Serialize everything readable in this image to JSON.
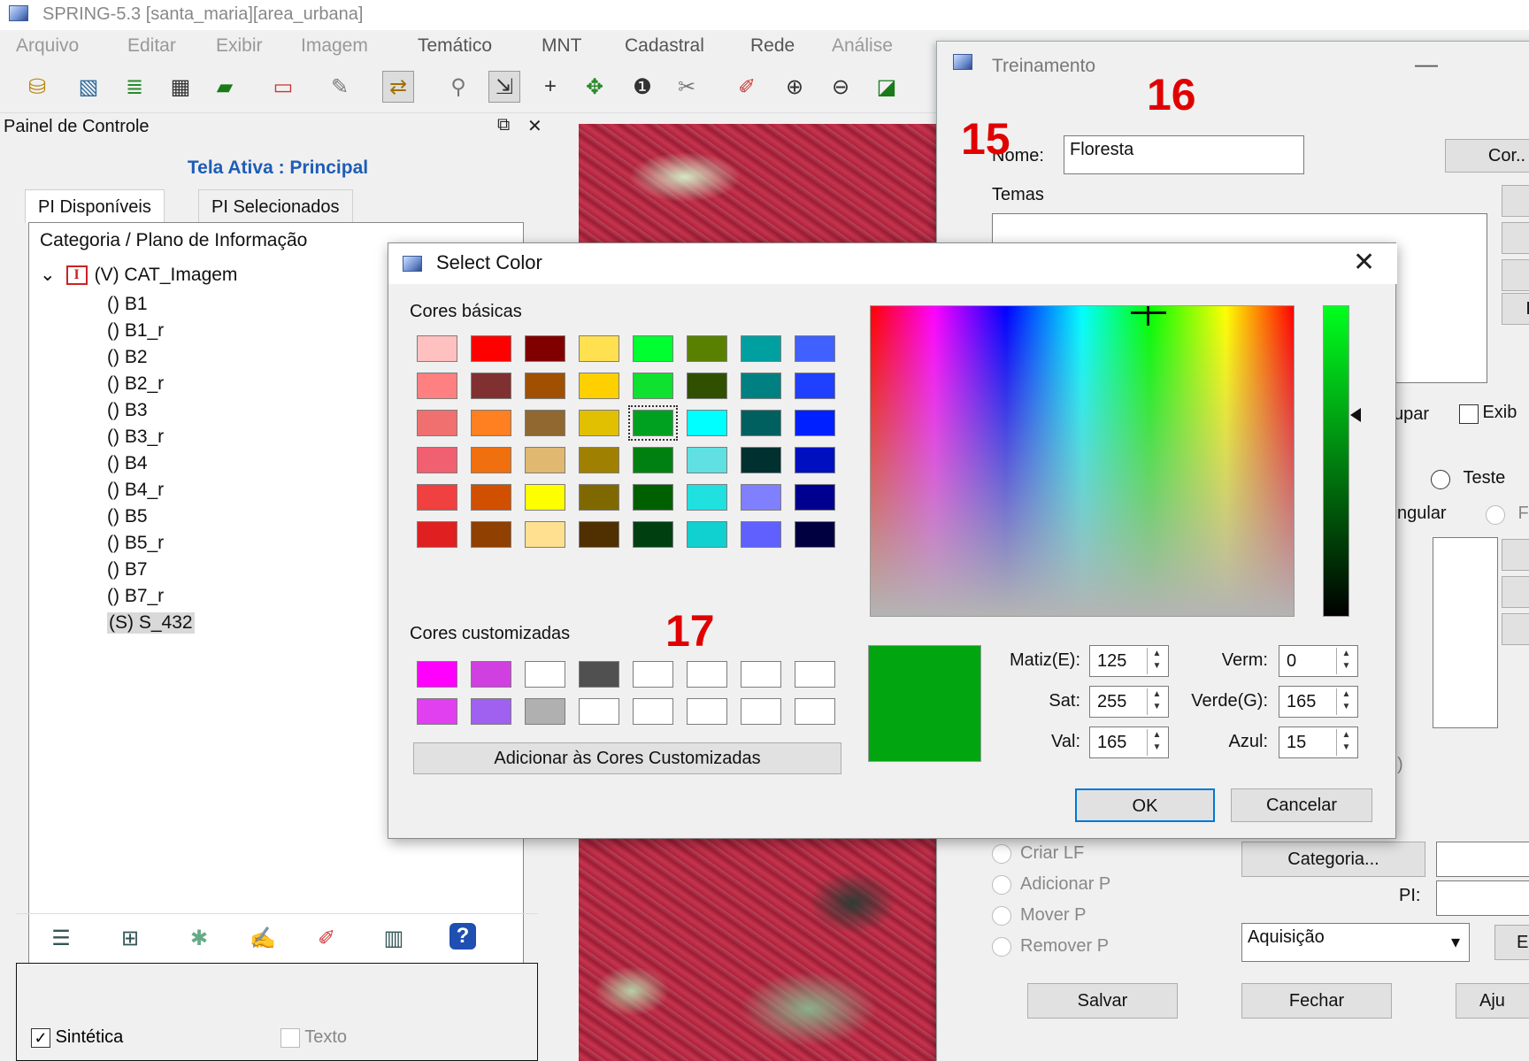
{
  "main_window": {
    "title": "SPRING-5.3 [santa_maria][area_urbana]",
    "menu": [
      "Arquivo",
      "Editar",
      "Exibir",
      "Imagem",
      "Temático",
      "MNT",
      "Cadastral",
      "Rede",
      "Análise"
    ]
  },
  "toolbar": {
    "icons": [
      "database-icon",
      "image-icon",
      "layers-icon",
      "grid-icon",
      "polygon-icon",
      "window-icon",
      "query-icon",
      "link-icon",
      "search-icon",
      "select-icon",
      "crosshair-icon",
      "pan-icon",
      "info-icon",
      "measure-icon",
      "draw-icon",
      "zoom-in-icon",
      "zoom-out-icon",
      "zoom-area-icon"
    ]
  },
  "control_panel": {
    "title": "Painel de Controle",
    "active_screen": "Tela Ativa : Principal",
    "tabs": [
      "PI Disponíveis",
      "PI Selecionados"
    ],
    "tree_header": "Categoria / Plano de Informação",
    "category": "(V) CAT_Imagem",
    "category_icon_letter": "I",
    "layers": [
      "() B1",
      "() B1_r",
      "() B2",
      "() B2_r",
      "() B3",
      "() B3_r",
      "() B4",
      "() B4_r",
      "() B5",
      "() B5_r",
      "() B7",
      "() B7_r",
      "(S) S_432"
    ],
    "selected_layer": "(S) S_432",
    "sintetica_label": "Sintética",
    "texto_label": "Texto"
  },
  "training": {
    "title": "Treinamento",
    "name_label": "Nome:",
    "name_value": "Floresta",
    "color_button": "Cor..",
    "temas_label": "Temas",
    "side_button_i": "I",
    "agrupar_label": "upar",
    "exibir_label": "Exib",
    "teste_label": "Teste",
    "angular_label": "ngular",
    "r_label": "F",
    "paren_label": ")",
    "radios": [
      "Criar LF",
      "Adicionar P",
      "Mover P",
      "Remover P"
    ],
    "categoria_button": "Categoria...",
    "pi_label": "PI:",
    "aquisicao_value": "Aquisição",
    "b_label": "E",
    "buttons": {
      "save": "Salvar",
      "close": "Fechar",
      "adjust": "Aju"
    }
  },
  "select_color": {
    "title": "Select Color",
    "basic_label": "Cores básicas",
    "custom_label": "Cores customizadas",
    "add_custom_button": "Adicionar às Cores Customizadas",
    "basic_colors": [
      [
        "#ffc0c0",
        "#ff0000",
        "#800000",
        "#ffe050",
        "#00ff30",
        "#5a8000",
        "#00a0a0",
        "#4060ff"
      ],
      [
        "#ff8080",
        "#803030",
        "#a05000",
        "#ffd000",
        "#10e030",
        "#305000",
        "#008080",
        "#2040ff"
      ],
      [
        "#f07070",
        "#ff8020",
        "#906830",
        "#e0c000",
        "#00a020",
        "#00ffff",
        "#006060",
        "#0020ff"
      ],
      [
        "#f06070",
        "#f07010",
        "#e0b870",
        "#a08000",
        "#008010",
        "#60e0e0",
        "#003030",
        "#0010c0"
      ],
      [
        "#f04040",
        "#d05000",
        "#ffff00",
        "#806800",
        "#006000",
        "#20e0e0",
        "#8080ff",
        "#000090"
      ],
      [
        "#e02020",
        "#904000",
        "#ffe090",
        "#503000",
        "#004010",
        "#10d0d0",
        "#6060ff",
        "#000040"
      ]
    ],
    "focused_swatch": "2-4",
    "custom_colors": [
      [
        "#ff00ff",
        "#d040e0",
        "#ffffff",
        "#505050",
        "#ffffff",
        "#ffffff",
        "#ffffff",
        "#ffffff"
      ],
      [
        "#e040f0",
        "#a060f0",
        "#b0b0b0",
        "#ffffff",
        "#ffffff",
        "#ffffff",
        "#ffffff",
        "#ffffff"
      ]
    ],
    "selected_color": "#00a50f",
    "hue_label": "Matiz(E):",
    "hue": "125",
    "sat_label": "Sat:",
    "sat": "255",
    "val_label": "Val:",
    "val": "165",
    "red_label": "Verm:",
    "red": "0",
    "green_label": "Verde(G):",
    "green": "165",
    "blue_label": "Azul:",
    "blue": "15",
    "ok": "OK",
    "cancel": "Cancelar"
  },
  "annotations": {
    "a15": "15",
    "a16": "16",
    "a17": "17"
  }
}
